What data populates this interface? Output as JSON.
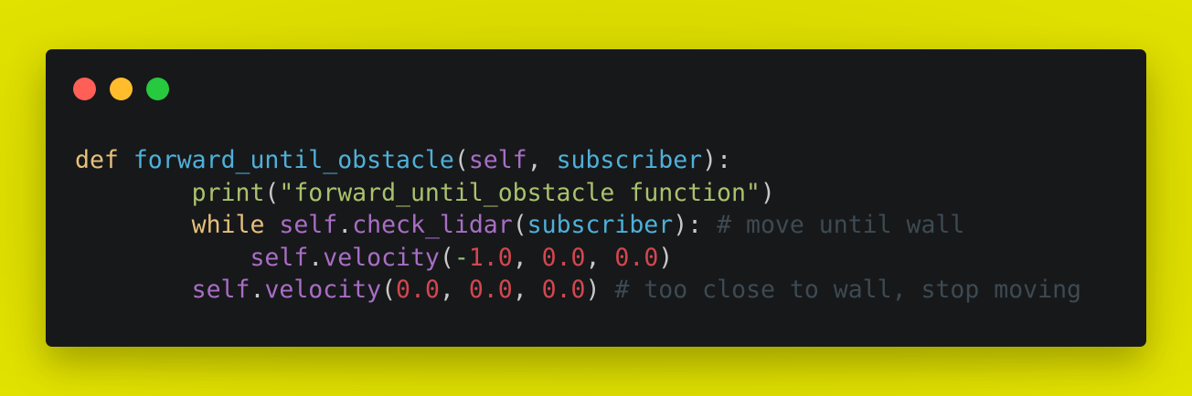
{
  "window": {
    "buttons": {
      "close": "close",
      "minimize": "minimize",
      "maximize": "maximize"
    }
  },
  "code": {
    "line1": {
      "kw_def": "def",
      "fn_name": "forward_until_obstacle",
      "open": "(",
      "self": "self",
      "comma": ", ",
      "param": "subscriber",
      "close": "):"
    },
    "line2": {
      "indent": "        ",
      "builtin": "print",
      "open": "(",
      "string": "\"forward_until_obstacle function\"",
      "close": ")"
    },
    "line3": {
      "indent": "        ",
      "kw_while": "while",
      "sp": " ",
      "self": "self",
      "dot": ".",
      "method": "check_lidar",
      "open": "(",
      "param": "subscriber",
      "close": "): ",
      "comment": "# move until wall"
    },
    "line4": {
      "indent": "            ",
      "self": "self",
      "dot": ".",
      "method": "velocity",
      "open": "(",
      "minus": "-",
      "n1": "1.0",
      "c1": ", ",
      "n2": "0.0",
      "c2": ", ",
      "n3": "0.0",
      "close": ")"
    },
    "line5": {
      "indent": "        ",
      "self": "self",
      "dot": ".",
      "method": "velocity",
      "open": "(",
      "n1": "0.0",
      "c1": ", ",
      "n2": "0.0",
      "c2": ", ",
      "n3": "0.0",
      "close": ") ",
      "comment": "# too close to wall, stop moving"
    }
  }
}
